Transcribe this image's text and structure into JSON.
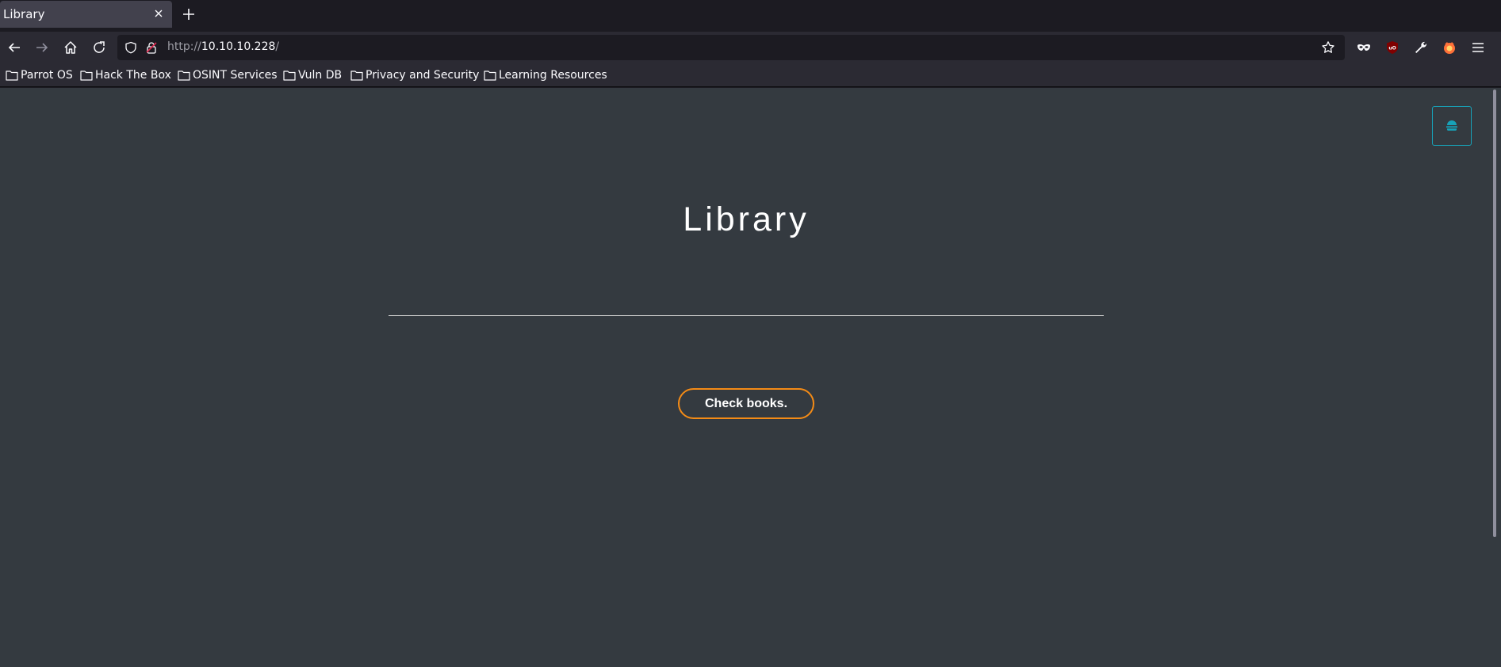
{
  "browser": {
    "tab": {
      "title": "Library"
    },
    "url": {
      "protocol": "http://",
      "host": "10.10.10.228",
      "path": "/"
    },
    "bookmarks": [
      {
        "label": "Parrot OS"
      },
      {
        "label": "Hack The Box"
      },
      {
        "label": "OSINT Services"
      },
      {
        "label": "Vuln DB"
      },
      {
        "label": "Privacy and Security"
      },
      {
        "label": "Learning Resources"
      }
    ],
    "extensions": [
      "incognito-mask-icon",
      "ublock-origin-icon",
      "wrench-icon",
      "firefox-devtools-icon"
    ]
  },
  "page": {
    "title": "Library",
    "cta_label": "Check books.",
    "menu_toggle_icon": "hamburger-icon"
  },
  "colors": {
    "page_background": "#343a40",
    "accent_orange": "#f48b16",
    "accent_teal": "#17a2b8"
  }
}
